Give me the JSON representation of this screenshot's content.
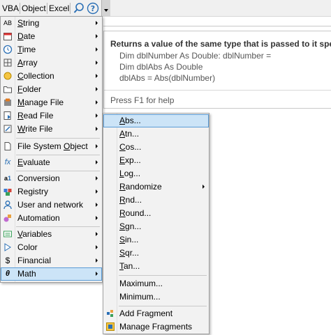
{
  "toolbar": {
    "vba": "VBA",
    "object": "Object",
    "excel": "Excel"
  },
  "help": {
    "title": "Returns a value of the same type that is passed to it specif",
    "line1": "Dim dblNumber As Double: dblNumber =",
    "line2": "Dim dblAbs As Double",
    "line3": "dblAbs = Abs(dblNumber)",
    "footer": "Press F1 for help"
  },
  "main_menu": {
    "string": {
      "u": "S",
      "rest": "tring"
    },
    "date": {
      "u": "D",
      "rest": "ate"
    },
    "time": {
      "u": "T",
      "rest": "ime"
    },
    "array": {
      "u": "A",
      "rest": "rray"
    },
    "collection": {
      "u": "C",
      "rest": "ollection"
    },
    "folder": {
      "u": "F",
      "rest": "older"
    },
    "manage_file": {
      "u": "M",
      "rest": "anage File"
    },
    "read_file": {
      "u": "R",
      "rest": "ead File"
    },
    "write_file": {
      "u": "W",
      "rest": "rite File"
    },
    "fso": {
      "pre": "File System ",
      "u": "O",
      "rest": "bject"
    },
    "evaluate": {
      "u": "E",
      "rest": "valuate"
    },
    "conversion": "Conversion",
    "registry": "Registry",
    "user_network": "User and network",
    "automation": "Automation",
    "variables": {
      "u": "V",
      "rest": "ariables"
    },
    "color": "Color",
    "financial": "Financial",
    "math": "Math"
  },
  "math_menu": {
    "abs": {
      "u": "A",
      "rest": "bs..."
    },
    "atn": {
      "u": "A",
      "rest": "tn..."
    },
    "cos": {
      "u": "C",
      "rest": "os..."
    },
    "exp": {
      "u": "E",
      "rest": "xp..."
    },
    "log": {
      "u": "L",
      "rest": "og..."
    },
    "randomize": {
      "u": "R",
      "rest": "andomize"
    },
    "rnd": {
      "u": "R",
      "rest": "nd..."
    },
    "round": {
      "u": "R",
      "rest": "ound..."
    },
    "sgn": {
      "u": "S",
      "rest": "gn..."
    },
    "sin": {
      "u": "S",
      "rest": "in..."
    },
    "sqr": {
      "u": "S",
      "rest": "qr..."
    },
    "tan": {
      "u": "T",
      "rest": "an..."
    },
    "maximum": "Maximum...",
    "minimum": "Minimum...",
    "add_fragment": "Add Fragment",
    "manage_fragments": "Manage Fragments"
  },
  "colors": {
    "highlight_bg": "#cce4f7",
    "highlight_border": "#5a9bd5",
    "menu_bg": "#f2f2f2"
  }
}
